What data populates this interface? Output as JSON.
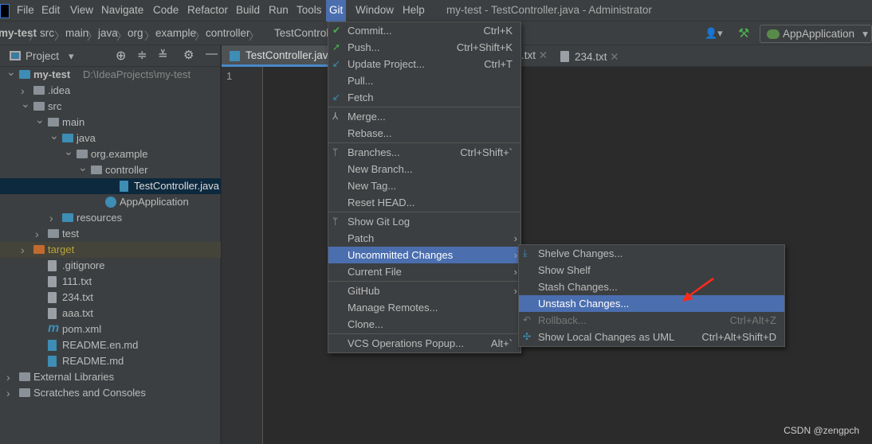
{
  "menubar": {
    "items": [
      "File",
      "Edit",
      "View",
      "Navigate",
      "Code",
      "Refactor",
      "Build",
      "Run",
      "Tools",
      "Git",
      "Window",
      "Help"
    ],
    "active": "Git"
  },
  "window_title": "my-test - TestController.java - Administrator",
  "breadcrumb": [
    "my-test",
    "src",
    "main",
    "java",
    "org",
    "example",
    "controller",
    "TestController"
  ],
  "run_config": "AppApplication",
  "project_panel": {
    "title": "Project"
  },
  "tree": [
    {
      "label": "my-test",
      "extra": "D:\\IdeaProjects\\my-test",
      "depth": 0,
      "exp": "open",
      "icon": "module-folder-icon"
    },
    {
      "label": ".idea",
      "depth": 1,
      "exp": "closed",
      "icon": "folder-icon"
    },
    {
      "label": "src",
      "depth": 1,
      "exp": "open",
      "icon": "folder-icon"
    },
    {
      "label": "main",
      "depth": 2,
      "exp": "open",
      "icon": "folder-icon"
    },
    {
      "label": "java",
      "depth": 3,
      "exp": "open",
      "icon": "source-folder-icon"
    },
    {
      "label": "org.example",
      "depth": 4,
      "exp": "open",
      "icon": "package-icon"
    },
    {
      "label": "controller",
      "depth": 5,
      "exp": "open",
      "icon": "package-icon"
    },
    {
      "label": "TestController.java",
      "depth": 7,
      "exp": "",
      "icon": "java-file-icon",
      "selected": true
    },
    {
      "label": "AppApplication",
      "depth": 6,
      "exp": "",
      "icon": "spring-boot-class-icon"
    },
    {
      "label": "resources",
      "depth": 3,
      "exp": "closed",
      "icon": "resources-folder-icon"
    },
    {
      "label": "test",
      "depth": 2,
      "exp": "closed",
      "icon": "folder-icon"
    },
    {
      "label": "target",
      "depth": 1,
      "exp": "closed",
      "icon": "excluded-folder-icon",
      "target": true
    },
    {
      "label": ".gitignore",
      "depth": 2,
      "exp": "",
      "icon": "ignore-file-icon"
    },
    {
      "label": "111.txt",
      "depth": 2,
      "exp": "",
      "icon": "text-file-icon"
    },
    {
      "label": "234.txt",
      "depth": 2,
      "exp": "",
      "icon": "text-file-icon"
    },
    {
      "label": "aaa.txt",
      "depth": 2,
      "exp": "",
      "icon": "text-file-icon"
    },
    {
      "label": "pom.xml",
      "depth": 2,
      "exp": "",
      "icon": "maven-icon"
    },
    {
      "label": "README.en.md",
      "depth": 2,
      "exp": "",
      "icon": "markdown-file-icon"
    },
    {
      "label": "README.md",
      "depth": 2,
      "exp": "",
      "icon": "markdown-file-icon"
    },
    {
      "label": "External Libraries",
      "depth": 0,
      "exp": "closed",
      "icon": "libraries-icon"
    },
    {
      "label": "Scratches and Consoles",
      "depth": 0,
      "exp": "closed",
      "icon": "scratches-icon"
    }
  ],
  "tabs": [
    {
      "label": "TestController.java",
      "active": true
    },
    {
      "label": ".txt"
    },
    {
      "label": "234.txt"
    }
  ],
  "editor": {
    "line_numbers": [
      "1"
    ]
  },
  "git_menu": [
    {
      "label": "Commit...",
      "sc": "Ctrl+K",
      "icon": "✔",
      "color": "#4caf50"
    },
    {
      "label": "Push...",
      "sc": "Ctrl+Shift+K",
      "icon": "➚",
      "color": "#4caf50"
    },
    {
      "label": "Update Project...",
      "sc": "Ctrl+T",
      "icon": "↙",
      "color": "#3d8db5"
    },
    {
      "label": "Pull..."
    },
    {
      "label": "Fetch",
      "icon": "↙",
      "color": "#3d8db5",
      "sepAfter": true
    },
    {
      "label": "Merge...",
      "icon": "⅄",
      "color": "#aaa"
    },
    {
      "label": "Rebase...",
      "sepAfter": true
    },
    {
      "label": "Branches...",
      "sc": "Ctrl+Shift+`",
      "icon": "ᛘ",
      "color": "#aaa"
    },
    {
      "label": "New Branch..."
    },
    {
      "label": "New Tag..."
    },
    {
      "label": "Reset HEAD...",
      "sepAfter": true
    },
    {
      "label": "Show Git Log",
      "icon": "ᛘ",
      "color": "#aaa"
    },
    {
      "label": "Patch",
      "sub": true
    },
    {
      "label": "Uncommitted Changes",
      "sub": true,
      "hl": true
    },
    {
      "label": "Current File",
      "sub": true,
      "sepAfter": true
    },
    {
      "label": "GitHub",
      "sub": true
    },
    {
      "label": "Manage Remotes..."
    },
    {
      "label": "Clone...",
      "sepAfter": true
    },
    {
      "label": "VCS Operations Popup...",
      "sc": "Alt+`"
    }
  ],
  "uncommitted_submenu": [
    {
      "label": "Shelve Changes...",
      "icon": "⤓",
      "color": "#3d8db5"
    },
    {
      "label": "Show Shelf"
    },
    {
      "label": "Stash Changes..."
    },
    {
      "label": "Unstash Changes...",
      "hl": true
    },
    {
      "label": "Rollback...",
      "sc": "Ctrl+Alt+Z",
      "icon": "↶",
      "disabled": true,
      "color": "#777"
    },
    {
      "label": "Show Local Changes as UML",
      "sc": "Ctrl+Alt+Shift+D",
      "icon": "✣",
      "color": "#3d8db5"
    }
  ],
  "watermark": "CSDN @zengpch",
  "colors": {
    "selection": "#4b6eaf",
    "annotation_arrow": "#ff2a1a"
  }
}
